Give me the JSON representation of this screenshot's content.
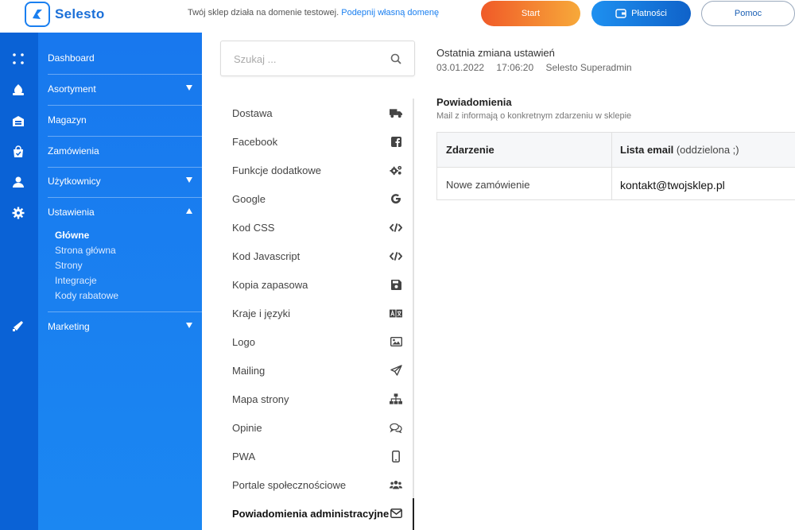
{
  "brand": {
    "name": "Selesto",
    "color": "#1a7ff0"
  },
  "header": {
    "domain_note": "Twój sklep działa na domenie testowej.",
    "domain_link": "Podepnij własną domenę",
    "start_label": "Start",
    "payments_label": "Płatności",
    "help_label": "Pomoc"
  },
  "rail": {
    "icons": [
      "dashboard-icon",
      "assortment-icon",
      "warehouse-icon",
      "orders-icon",
      "user-icon",
      "gear-icon",
      "marketing-icon"
    ]
  },
  "sidebar": {
    "items": [
      {
        "label": "Dashboard"
      },
      {
        "label": "Asortyment"
      },
      {
        "label": "Magazyn"
      },
      {
        "label": "Zamówienia"
      },
      {
        "label": "Użytkownicy"
      },
      {
        "label": "Ustawienia"
      },
      {
        "label": "Marketing"
      }
    ],
    "submenu": [
      {
        "label": "Główne",
        "active": true
      },
      {
        "label": "Strona główna"
      },
      {
        "label": "Strony"
      },
      {
        "label": "Integracje"
      },
      {
        "label": "Kody rabatowe"
      }
    ]
  },
  "settings": {
    "search_placeholder": "Szukaj ...",
    "items": [
      {
        "label": "Dostawa",
        "icon": "truck-icon"
      },
      {
        "label": "Facebook",
        "icon": "facebook-icon"
      },
      {
        "label": "Funkcje dodatkowe",
        "icon": "gears-icon"
      },
      {
        "label": "Google",
        "icon": "google-icon"
      },
      {
        "label": "Kod CSS",
        "icon": "code-icon"
      },
      {
        "label": "Kod Javascript",
        "icon": "code-icon"
      },
      {
        "label": "Kopia zapasowa",
        "icon": "floppy-icon"
      },
      {
        "label": "Kraje i języki",
        "icon": "language-icon"
      },
      {
        "label": "Logo",
        "icon": "image-icon"
      },
      {
        "label": "Mailing",
        "icon": "paper-plane-icon"
      },
      {
        "label": "Mapa strony",
        "icon": "sitemap-icon"
      },
      {
        "label": "Opinie",
        "icon": "comments-icon"
      },
      {
        "label": "PWA",
        "icon": "mobile-icon"
      },
      {
        "label": "Portale społecznościowe",
        "icon": "users-icon"
      },
      {
        "label": "Powiadomienia administracyjne",
        "icon": "envelope-icon",
        "active": true
      }
    ]
  },
  "main": {
    "last_change_title": "Ostatnia zmiana ustawień",
    "last_change_date": "03.01.2022",
    "last_change_time": "17:06:20",
    "last_change_user": "Selesto Superadmin",
    "section_title": "Powiadomienia",
    "section_subtitle": "Mail z informają o konkretnym zdarzeniu w sklepie",
    "table": {
      "col_event": "Zdarzenie",
      "col_email": "Lista email",
      "col_email_note": "(oddzielona ;)",
      "rows": [
        {
          "event": "Nowe zamówienie",
          "email": "kontakt@twojsklep.pl"
        }
      ]
    }
  }
}
